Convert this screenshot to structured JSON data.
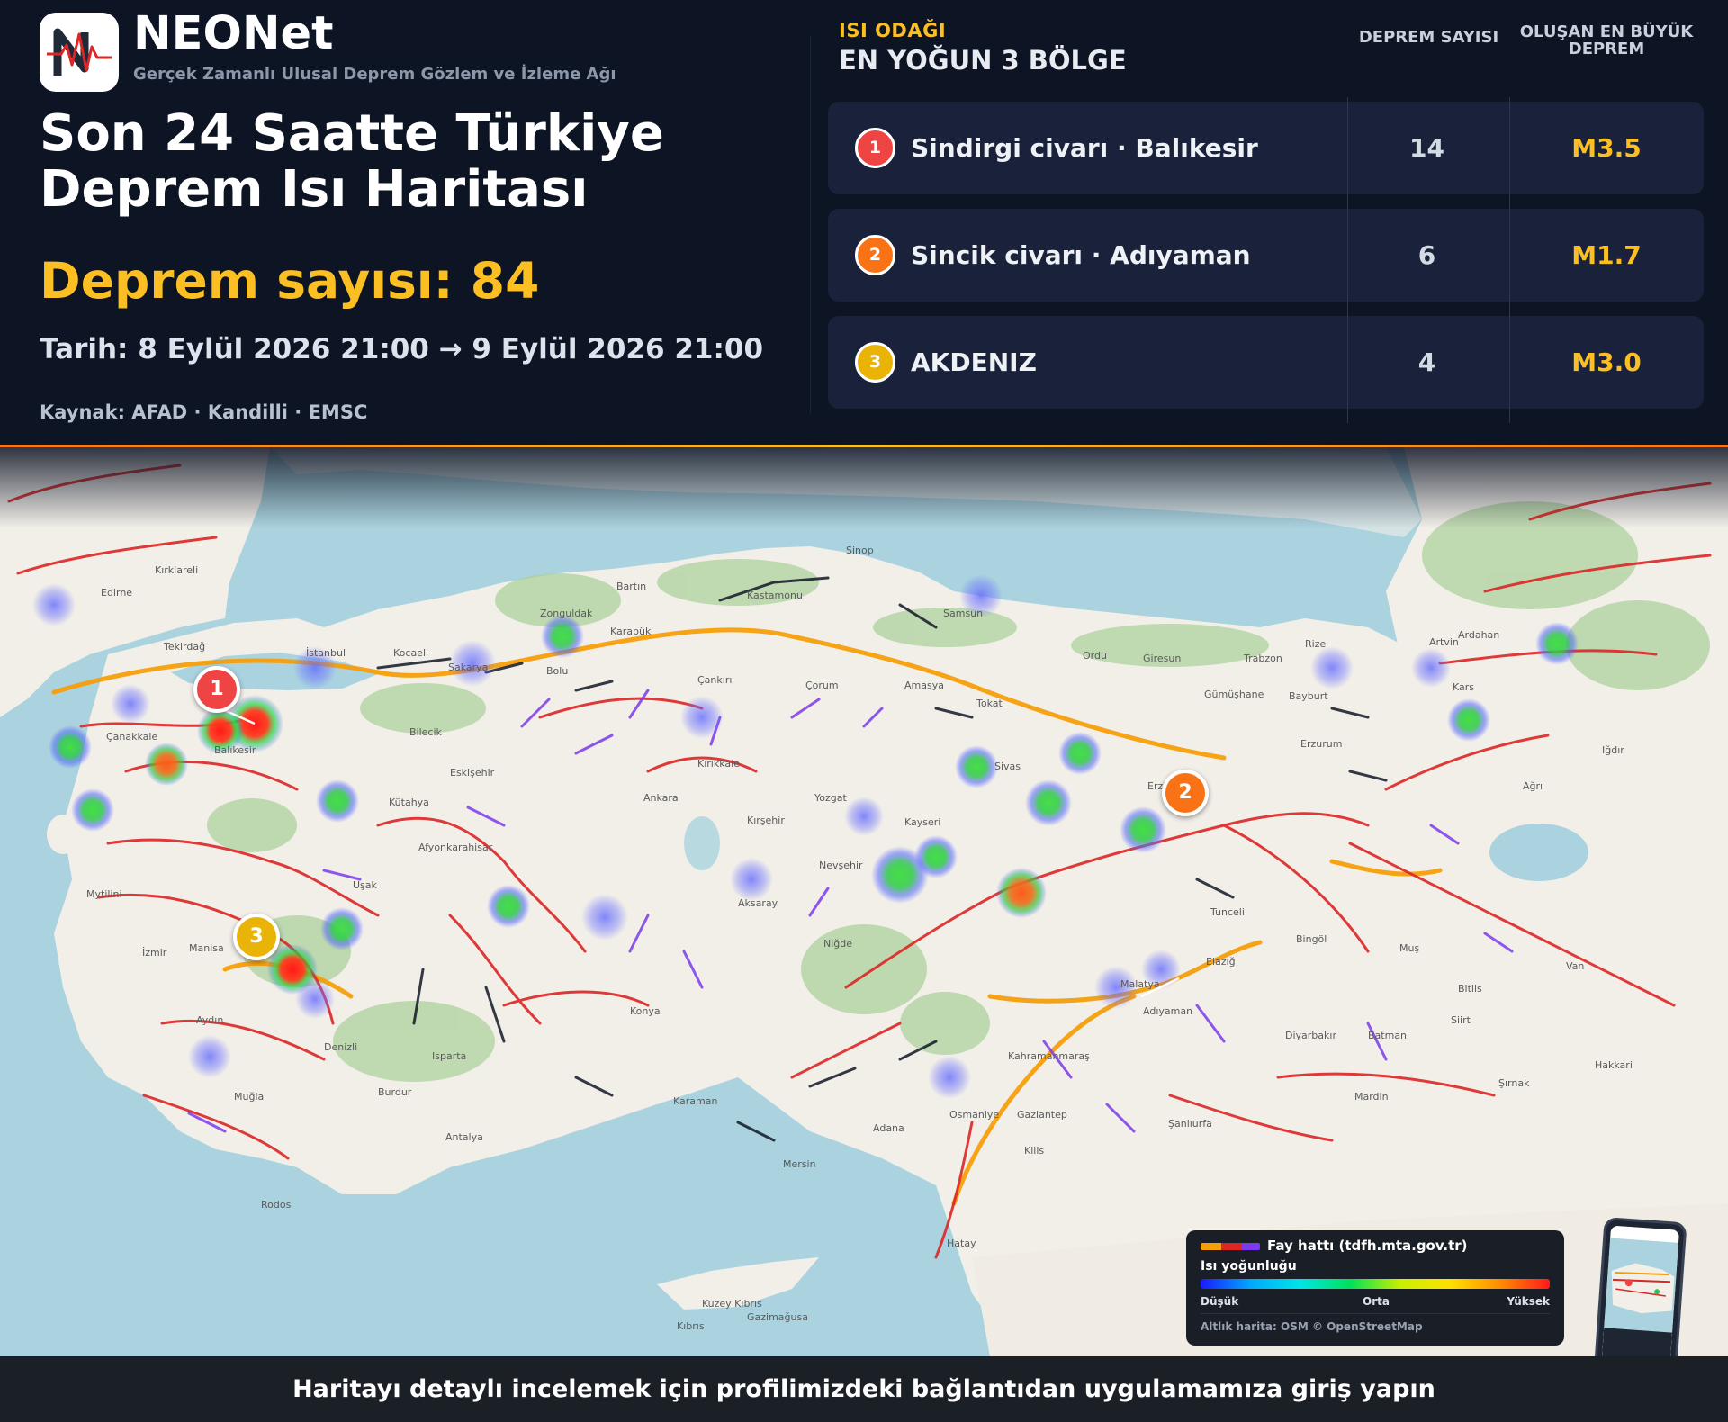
{
  "brand": {
    "name": "NEONet",
    "tagline": "Gerçek Zamanlı Ulusal Deprem Gözlem ve İzleme Ağı",
    "logo_icon": "seismograph-logo-icon"
  },
  "header": {
    "title_line1": "Son 24 Saatte Türkiye",
    "title_line2": "Deprem Isı Haritası",
    "count_text": "Deprem sayısı: 84",
    "date_text": "Tarih: 8 Eylül 2026 21:00 → 9 Eylül 2026 21:00",
    "source_text": "Kaynak: AFAD · Kandilli · EMSC",
    "accent_color": "#fbbf24"
  },
  "hotspots": {
    "label": "ISI ODAĞI",
    "title": "EN YOĞUN 3 BÖLGE",
    "col_count": "DEPREM SAYISI",
    "col_mag": "OLUŞAN EN BÜYÜK DEPREM",
    "rows": [
      {
        "rank": "1",
        "name": "Sindirgi civarı · Balıkesir",
        "count": "14",
        "mag": "M3.5",
        "color": "#ef4444"
      },
      {
        "rank": "2",
        "name": "Sincik civarı · Adıyaman",
        "count": "6",
        "mag": "M1.7",
        "color": "#f97316"
      },
      {
        "rank": "3",
        "name": "AKDENIZ",
        "count": "4",
        "mag": "M3.0",
        "color": "#eab308"
      }
    ]
  },
  "map": {
    "labels": [
      "Sinop",
      "Kastamonu",
      "Samsun",
      "Ordu",
      "Giresun",
      "Trabzon",
      "Rize",
      "Artvin",
      "Ardahan",
      "İstanbul",
      "Kocaeli",
      "Sakarya",
      "Bolu",
      "Zonguldak",
      "Karabük",
      "Bartın",
      "Çankırı",
      "Çorum",
      "Amasya",
      "Tokat",
      "Edirne",
      "Kırklareli",
      "Tekirdağ",
      "Çanakkale",
      "Balıkesir",
      "Bilecik",
      "Eskişehir",
      "Kütahya",
      "Ankara",
      "Kırıkkale",
      "Yozgat",
      "Sivas",
      "Erzincan",
      "Erzurum",
      "Bayburt",
      "Gümüşhane",
      "Kars",
      "Ağrı",
      "Iğdır",
      "Manisa",
      "İzmir",
      "Uşak",
      "Afyonkarahisar",
      "Aydın",
      "Denizli",
      "Muğla",
      "Burdur",
      "Isparta",
      "Antalya",
      "Kırşehir",
      "Nevşehir",
      "Kayseri",
      "Aksaray",
      "Niğde",
      "Konya",
      "Karaman",
      "Mersin",
      "Adana",
      "Osmaniye",
      "Kahramanmaraş",
      "Malatya",
      "Elazığ",
      "Tunceli",
      "Bingöl",
      "Muş",
      "Bitlis",
      "Van",
      "Hakkari",
      "Şırnak",
      "Adıyaman",
      "Diyarbakır",
      "Batman",
      "Siirt",
      "Mardin",
      "Şanlıurfa",
      "Gaziantep",
      "Kilis",
      "Hatay",
      "Rodos",
      "Kıbrıs",
      "Mytilini",
      "Gazimağusa",
      "Kuzey Kıbrıs"
    ],
    "marker_colors": [
      "#ef4444",
      "#f97316",
      "#eab308"
    ],
    "sea_color": "#aad3df",
    "land_color": "#f2efe9",
    "forest_color": "#add19e",
    "fault_colors": {
      "main": "#f59e0b",
      "active": "#dc2626",
      "minor": "#7c3aed",
      "other": "#111827"
    }
  },
  "legend": {
    "fault_line": "Fay hattı (tdfh.mta.gov.tr)",
    "heat_title": "Isı yoğunluğu",
    "low": "Düşük",
    "mid": "Orta",
    "high": "Yüksek",
    "basemap": "Altlık harita: OSM © OpenStreetMap"
  },
  "footer": {
    "cta": "Haritayı detaylı incelemek için profilimizdeki bağlantıdan uygulamamıza giriş yapın"
  }
}
